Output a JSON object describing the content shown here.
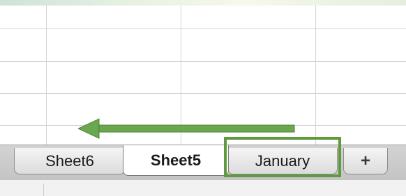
{
  "sheet_tabs": [
    {
      "label": "Sheet6",
      "active": false
    },
    {
      "label": "Sheet5",
      "active": true
    },
    {
      "label": "January",
      "active": false
    }
  ],
  "add_sheet_label": "+",
  "annotation": {
    "highlight_color": "#5f9a3d",
    "arrow_color": "#6aa84f",
    "arrow_direction": "left"
  },
  "colors": {
    "grid_line": "#d4d4d4",
    "tab_bar": "#c8c8c8"
  }
}
